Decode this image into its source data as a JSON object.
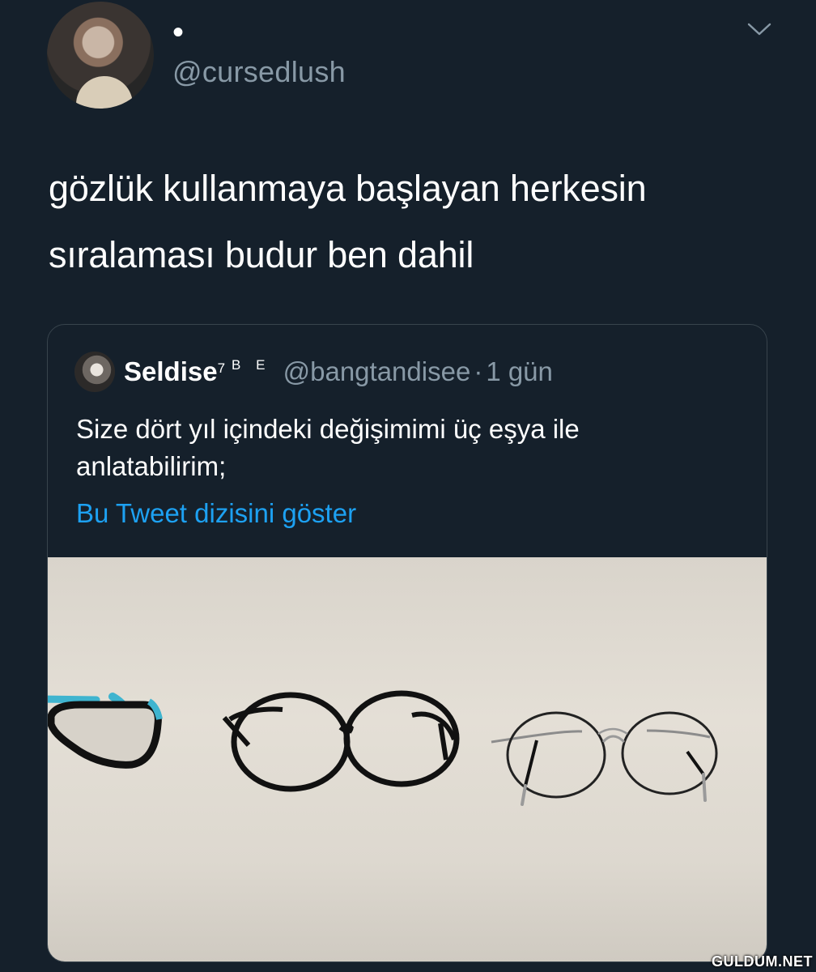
{
  "tweet": {
    "display_name": "•",
    "handle": "@cursedlush",
    "text_line1": "gözlük kullanmaya başlayan herkesin",
    "text_line2": "sıralaması budur ben dahil"
  },
  "quoted_tweet": {
    "name": "Seldise",
    "name_sup": "7",
    "name_suffix": "B E",
    "handle": "@bangtandisee",
    "separator": "·",
    "time": "1 gün",
    "text_line1": "Size dört yıl içindeki değişimimi üç eşya ile",
    "text_line2": "anlatabilirim;",
    "thread_link": "Bu Tweet dizisini göster"
  },
  "icons": {
    "options": "chevron-down-icon"
  },
  "watermark": "GULDUM.NET",
  "colors": {
    "background": "#15202b",
    "secondary_text": "#8899a6",
    "link": "#1da1f2",
    "border": "#38444d"
  }
}
